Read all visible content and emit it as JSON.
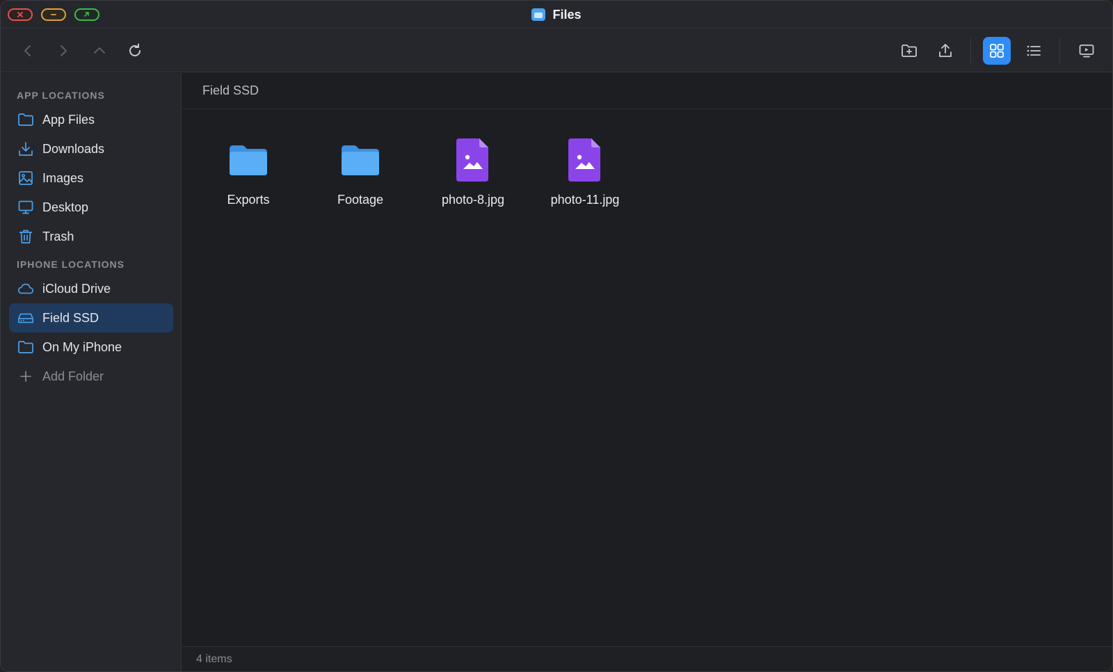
{
  "window": {
    "title": "Files"
  },
  "toolbar": {
    "buttons": [
      {
        "name": "back-button",
        "icon": "chevron-left-icon"
      },
      {
        "name": "forward-button",
        "icon": "chevron-right-icon"
      },
      {
        "name": "up-button",
        "icon": "chevron-up-icon"
      },
      {
        "name": "refresh-button",
        "icon": "refresh-icon"
      },
      {
        "name": "new-folder-button",
        "icon": "folder-plus-icon"
      },
      {
        "name": "upload-button",
        "icon": "upload-icon"
      },
      {
        "name": "grid-view-button",
        "icon": "grid-icon",
        "active": true
      },
      {
        "name": "list-view-button",
        "icon": "list-icon"
      },
      {
        "name": "present-button",
        "icon": "screen-play-icon"
      }
    ]
  },
  "sidebar": {
    "app_locations_title": "APP LOCATIONS",
    "app_locations": [
      {
        "label": "App Files",
        "icon": "folder-icon"
      },
      {
        "label": "Downloads",
        "icon": "download-icon"
      },
      {
        "label": "Images",
        "icon": "image-icon"
      },
      {
        "label": "Desktop",
        "icon": "monitor-icon"
      },
      {
        "label": "Trash",
        "icon": "trash-icon"
      }
    ],
    "iphone_locations_title": "IPHONE LOCATIONS",
    "iphone_locations": [
      {
        "label": "iCloud Drive",
        "icon": "cloud-icon"
      },
      {
        "label": "Field SSD",
        "icon": "drive-icon",
        "selected": true
      },
      {
        "label": "On My iPhone",
        "icon": "folder-icon"
      }
    ],
    "add_folder_label": "Add Folder"
  },
  "main": {
    "path": "Field SSD",
    "items": [
      {
        "name": "Exports",
        "type": "folder"
      },
      {
        "name": "Footage",
        "type": "folder"
      },
      {
        "name": "photo-8.jpg",
        "type": "image"
      },
      {
        "name": "photo-11.jpg",
        "type": "image"
      }
    ],
    "status": "4 items"
  },
  "colors": {
    "accent": "#2f8cf5",
    "folder": "#4aa3f0",
    "image_file": "#8b44e8",
    "selected_bg": "#1f3a5c"
  }
}
